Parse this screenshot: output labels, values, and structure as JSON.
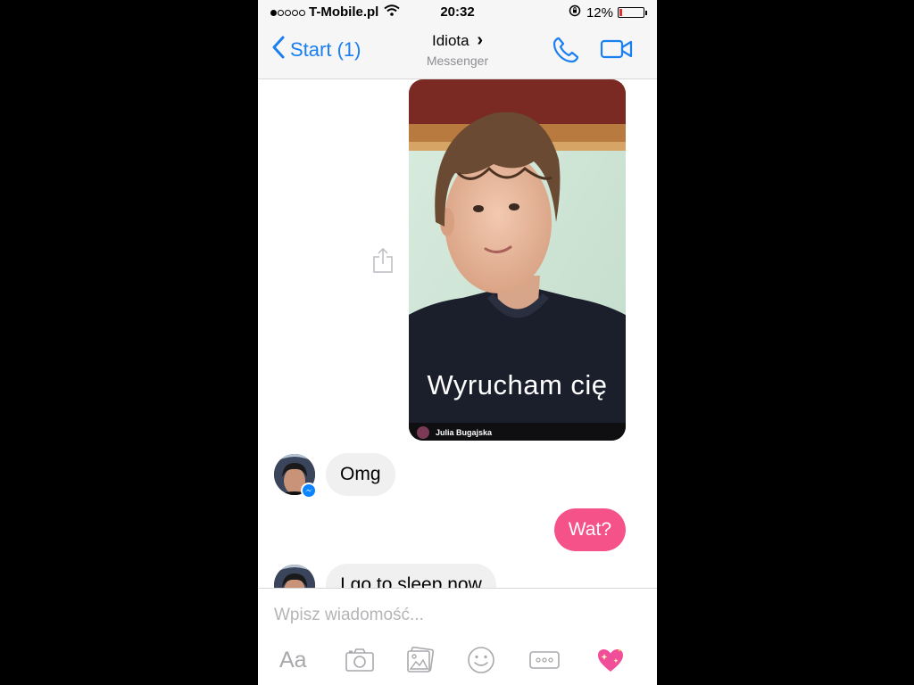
{
  "status_bar": {
    "carrier": "T-Mobile.pl",
    "time": "20:32",
    "battery": "12%",
    "battery_level": 0.12
  },
  "nav": {
    "back_label": "Start (1)",
    "title": "Idiota",
    "title_chevron": "›",
    "subtitle": "Messenger"
  },
  "messages": {
    "photo": {
      "caption": "Wyrucham cię",
      "author": "Julia Bugajska"
    },
    "incoming_1": "Omg",
    "outgoing_1": "Wat?",
    "incoming_2": "I go to sleep now"
  },
  "composer": {
    "placeholder": "Wpisz wiadomość...",
    "aa_label": "Aa"
  },
  "colors": {
    "accent": "#1a7ff0",
    "outgoing_bubble": "#f5528a",
    "incoming_bubble": "#f1f0f0"
  },
  "icons": [
    "wifi-icon",
    "rotation-lock-icon",
    "battery-icon",
    "back-chevron-icon",
    "phone-icon",
    "video-camera-icon",
    "share-icon",
    "messenger-badge-icon",
    "camera-icon",
    "gallery-icon",
    "smiley-icon",
    "more-icon",
    "sparkling-heart-icon"
  ]
}
